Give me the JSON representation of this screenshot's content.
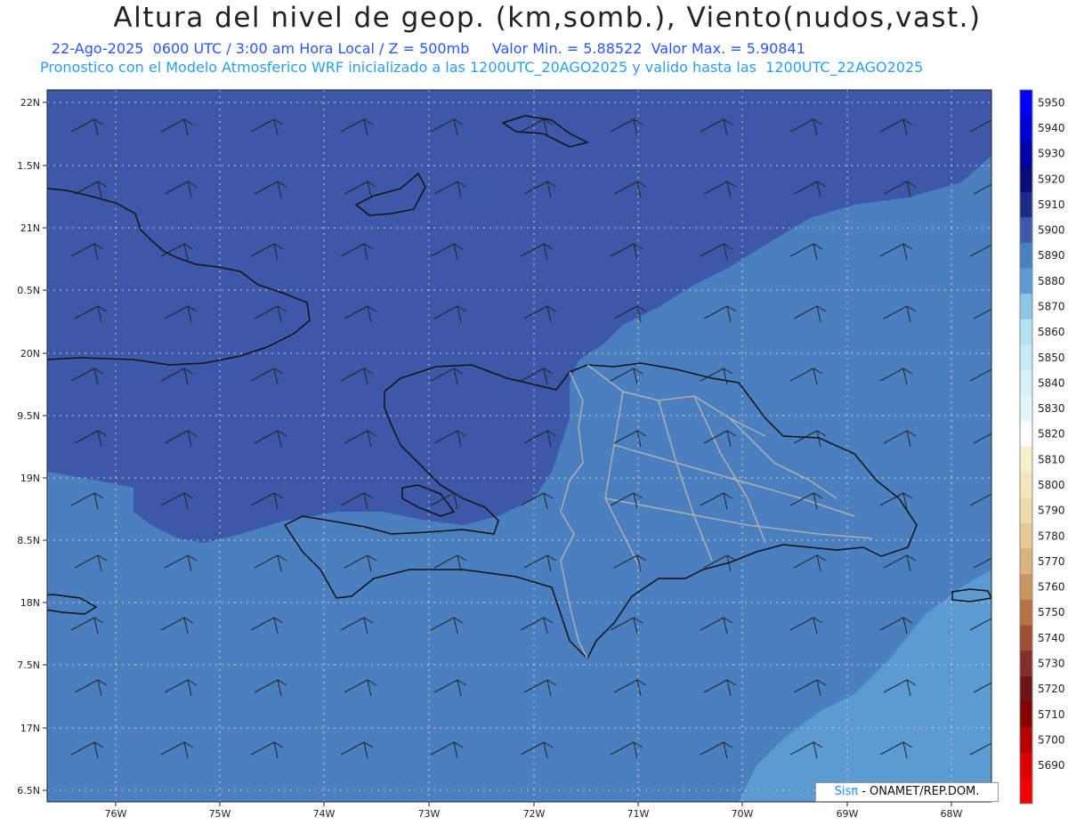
{
  "title": "Altura del nivel de geop. (km,somb.), Viento(nudos,vast.)",
  "subtitle_line1": "22-Ago-2025  0600 UTC / 3:00 am Hora Local / Z = 500mb     Valor Min. = 5.88522  Valor Max. = 5.90841",
  "subtitle_line2": "Pronostico con el Modelo Atmosferico WRF inicializado a las 1200UTC_20AGO2025 y valido hasta las  1200UTC_22AGO2025",
  "credit": {
    "brand": "Sisπ",
    "text": " - ONAMET/REP.DOM."
  },
  "colors": {
    "ocean_high": "#3d58a8",
    "ocean_mid": "#4a80c0",
    "ocean_low": "#5b9bd2",
    "coast": "#111111",
    "border": "#b0b0b0"
  },
  "lat_labels": [
    "22N",
    "1.5N",
    "21N",
    "0.5N",
    "20N",
    "9.5N",
    "19N",
    "8.5N",
    "18N",
    "7.5N",
    "17N",
    "6.5N"
  ],
  "lon_labels": [
    "76W",
    "75W",
    "74W",
    "73W",
    "72W",
    "71W",
    "70W",
    "69W",
    "68W"
  ],
  "colorbar": {
    "levels": [
      "5950",
      "5940",
      "5930",
      "5920",
      "5910",
      "5900",
      "5890",
      "5880",
      "5870",
      "5860",
      "5850",
      "5840",
      "5830",
      "5820",
      "5810",
      "5800",
      "5790",
      "5780",
      "5770",
      "5760",
      "5750",
      "5740",
      "5730",
      "5720",
      "5710",
      "5700",
      "5690"
    ],
    "colors": [
      "#0000ff",
      "#0000d6",
      "#0000a8",
      "#0a0a78",
      "#1e2a8a",
      "#3d58a8",
      "#4a80c0",
      "#5b9bd2",
      "#8ec6e6",
      "#b4e2f0",
      "#c6ecf6",
      "#d6f2fa",
      "#e4f8fc",
      "#ffffff",
      "#f7efc9",
      "#f3e6bc",
      "#eedbaa",
      "#e7c998",
      "#d9b27e",
      "#c9955e",
      "#b57346",
      "#9e4e33",
      "#842e28",
      "#6e1418",
      "#880000",
      "#b40000",
      "#dc0000",
      "#f00000"
    ]
  }
}
